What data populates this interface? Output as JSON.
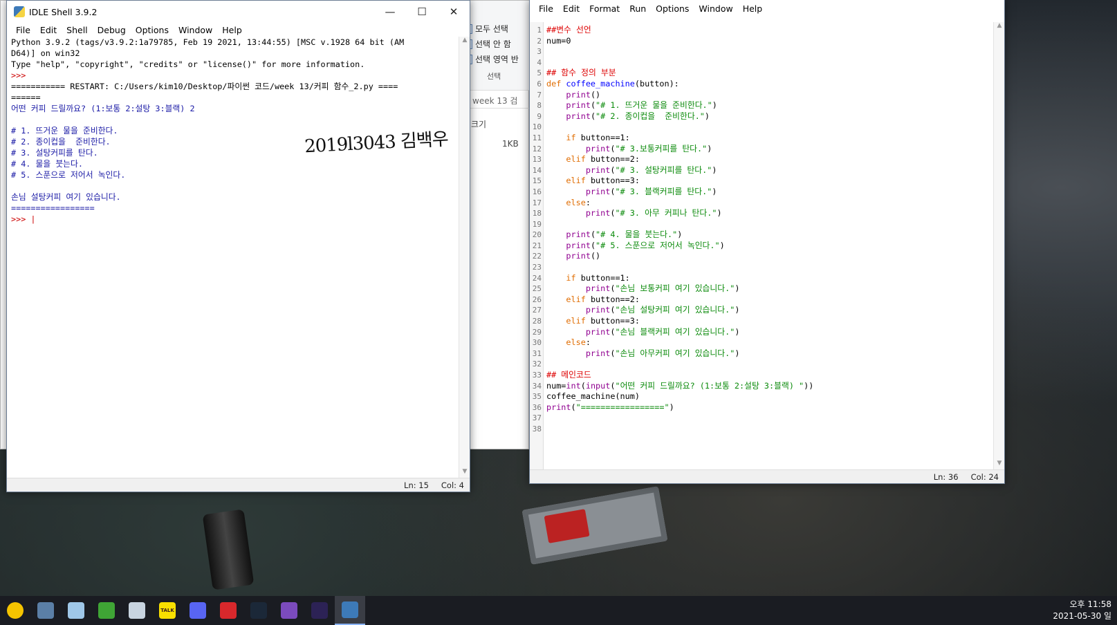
{
  "explorer": {
    "items": [
      "모두 선택",
      "선택 안 함",
      "선택 영역 반"
    ],
    "group_label": "선택",
    "search_text": "week 13 검",
    "col_size": "크기",
    "size_value": "1KB"
  },
  "shell": {
    "title": "IDLE Shell 3.9.2",
    "menu": [
      "File",
      "Edit",
      "Shell",
      "Debug",
      "Options",
      "Window",
      "Help"
    ],
    "lines": [
      {
        "t": "Python 3.9.2 (tags/v3.9.2:1a79785, Feb 19 2021, 13:44:55) [MSC v.1928 64 bit (AM",
        "c": "black"
      },
      {
        "t": "D64)] on win32",
        "c": "black"
      },
      {
        "t": "Type \"help\", \"copyright\", \"credits\" or \"license()\" for more information.",
        "c": "black"
      },
      {
        "t": ">>> ",
        "c": "red"
      },
      {
        "t": "=========== RESTART: C:/Users/kim10/Desktop/파이썬 코드/week 13/커피 함수_2.py ====",
        "c": "black"
      },
      {
        "t": "======",
        "c": "black"
      },
      {
        "t": "어떤 커피 드릴까요? (1:보통 2:설탕 3:블랙) 2",
        "c": "blue"
      },
      {
        "t": "",
        "c": "black"
      },
      {
        "t": "# 1. 뜨거운 물을 준비한다.",
        "c": "blue"
      },
      {
        "t": "# 2. 종이컵을  준비한다.",
        "c": "blue"
      },
      {
        "t": "# 3. 설탕커피를 탄다.",
        "c": "blue"
      },
      {
        "t": "# 4. 물을 붓는다.",
        "c": "blue"
      },
      {
        "t": "# 5. 스푼으로 저어서 녹인다.",
        "c": "blue"
      },
      {
        "t": "",
        "c": "black"
      },
      {
        "t": "손님 설탕커피 여기 있습니다.",
        "c": "blue"
      },
      {
        "t": "=================",
        "c": "blue"
      },
      {
        "t": ">>> |",
        "c": "red"
      }
    ],
    "signature": "2019l3043 김백우",
    "status_ln": "Ln: 15",
    "status_col": "Col: 4"
  },
  "editor": {
    "menu": [
      "File",
      "Edit",
      "Format",
      "Run",
      "Options",
      "Window",
      "Help"
    ],
    "line_numbers": [
      "1",
      "2",
      "3",
      "4",
      "5",
      "6",
      "7",
      "8",
      "9",
      "10",
      "11",
      "12",
      "13",
      "14",
      "15",
      "16",
      "17",
      "18",
      "19",
      "20",
      "21",
      "22",
      "23",
      "24",
      "25",
      "26",
      "27",
      "28",
      "29",
      "30",
      "31",
      "32",
      "33",
      "34",
      "35",
      "36",
      "37",
      "38"
    ],
    "code": [
      [
        [
          "cm",
          "##변수 선언"
        ]
      ],
      [
        [
          "",
          "num=0"
        ]
      ],
      [
        [
          "",
          ""
        ]
      ],
      [
        [
          "",
          ""
        ]
      ],
      [
        [
          "cm",
          "## 함수 정의 부분"
        ]
      ],
      [
        [
          "kw",
          "def "
        ],
        [
          "df",
          "coffee_machine"
        ],
        [
          "",
          "(button):"
        ]
      ],
      [
        [
          "",
          "    "
        ],
        [
          "bi",
          "print"
        ],
        [
          "",
          "()"
        ]
      ],
      [
        [
          "",
          "    "
        ],
        [
          "bi",
          "print"
        ],
        [
          "",
          "("
        ],
        [
          "str",
          "\"# 1. 뜨거운 물을 준비한다.\""
        ],
        [
          "",
          ")"
        ]
      ],
      [
        [
          "",
          "    "
        ],
        [
          "bi",
          "print"
        ],
        [
          "",
          "("
        ],
        [
          "str",
          "\"# 2. 종이컵을  준비한다.\""
        ],
        [
          "",
          ")"
        ]
      ],
      [
        [
          "",
          ""
        ]
      ],
      [
        [
          "",
          "    "
        ],
        [
          "kw",
          "if"
        ],
        [
          "",
          " button==1:"
        ]
      ],
      [
        [
          "",
          "        "
        ],
        [
          "bi",
          "print"
        ],
        [
          "",
          "("
        ],
        [
          "str",
          "\"# 3.보통커피를 탄다.\""
        ],
        [
          "",
          ")"
        ]
      ],
      [
        [
          "",
          "    "
        ],
        [
          "kw",
          "elif"
        ],
        [
          "",
          " button==2:"
        ]
      ],
      [
        [
          "",
          "        "
        ],
        [
          "bi",
          "print"
        ],
        [
          "",
          "("
        ],
        [
          "str",
          "\"# 3. 설탕커피를 탄다.\""
        ],
        [
          "",
          ")"
        ]
      ],
      [
        [
          "",
          "    "
        ],
        [
          "kw",
          "elif"
        ],
        [
          "",
          " button==3:"
        ]
      ],
      [
        [
          "",
          "        "
        ],
        [
          "bi",
          "print"
        ],
        [
          "",
          "("
        ],
        [
          "str",
          "\"# 3. 블랙커피를 탄다.\""
        ],
        [
          "",
          ")"
        ]
      ],
      [
        [
          "",
          "    "
        ],
        [
          "kw",
          "else"
        ],
        [
          "",
          ":"
        ]
      ],
      [
        [
          "",
          "        "
        ],
        [
          "bi",
          "print"
        ],
        [
          "",
          "("
        ],
        [
          "str",
          "\"# 3. 아무 커피나 탄다.\""
        ],
        [
          "",
          ")"
        ]
      ],
      [
        [
          "",
          ""
        ]
      ],
      [
        [
          "",
          "    "
        ],
        [
          "bi",
          "print"
        ],
        [
          "",
          "("
        ],
        [
          "str",
          "\"# 4. 물을 붓는다.\""
        ],
        [
          "",
          ")"
        ]
      ],
      [
        [
          "",
          "    "
        ],
        [
          "bi",
          "print"
        ],
        [
          "",
          "("
        ],
        [
          "str",
          "\"# 5. 스푼으로 저어서 녹인다.\""
        ],
        [
          "",
          ")"
        ]
      ],
      [
        [
          "",
          "    "
        ],
        [
          "bi",
          "print"
        ],
        [
          "",
          "()"
        ]
      ],
      [
        [
          "",
          ""
        ]
      ],
      [
        [
          "",
          "    "
        ],
        [
          "kw",
          "if"
        ],
        [
          "",
          " button==1:"
        ]
      ],
      [
        [
          "",
          "        "
        ],
        [
          "bi",
          "print"
        ],
        [
          "",
          "("
        ],
        [
          "str",
          "\"손님 보통커피 여기 있습니다.\""
        ],
        [
          "",
          ")"
        ]
      ],
      [
        [
          "",
          "    "
        ],
        [
          "kw",
          "elif"
        ],
        [
          "",
          " button==2:"
        ]
      ],
      [
        [
          "",
          "        "
        ],
        [
          "bi",
          "print"
        ],
        [
          "",
          "("
        ],
        [
          "str",
          "\"손님 설탕커피 여기 있습니다.\""
        ],
        [
          "",
          ")"
        ]
      ],
      [
        [
          "",
          "    "
        ],
        [
          "kw",
          "elif"
        ],
        [
          "",
          " button==3:"
        ]
      ],
      [
        [
          "",
          "        "
        ],
        [
          "bi",
          "print"
        ],
        [
          "",
          "("
        ],
        [
          "str",
          "\"손님 블랙커피 여기 있습니다.\""
        ],
        [
          "",
          ")"
        ]
      ],
      [
        [
          "",
          "    "
        ],
        [
          "kw",
          "else"
        ],
        [
          "",
          ":"
        ]
      ],
      [
        [
          "",
          "        "
        ],
        [
          "bi",
          "print"
        ],
        [
          "",
          "("
        ],
        [
          "str",
          "\"손님 아무커피 여기 있습니다.\""
        ],
        [
          "",
          ")"
        ]
      ],
      [
        [
          "",
          ""
        ]
      ],
      [
        [
          "cm",
          "## 메인코드"
        ]
      ],
      [
        [
          "",
          "num="
        ],
        [
          "bi",
          "int"
        ],
        [
          "",
          "("
        ],
        [
          "bi",
          "input"
        ],
        [
          "",
          "("
        ],
        [
          "str",
          "\"어떤 커피 드릴까요? (1:보통 2:설탕 3:블랙) \""
        ],
        [
          "",
          "))"
        ]
      ],
      [
        [
          "",
          "coffee_machine(num)"
        ]
      ],
      [
        [
          "bi",
          "print"
        ],
        [
          "",
          "("
        ],
        [
          "str",
          "\"=================\""
        ],
        [
          "",
          ")"
        ]
      ],
      [
        [
          "",
          ""
        ]
      ],
      [
        [
          "",
          ""
        ]
      ]
    ],
    "status_ln": "Ln: 36",
    "status_col": "Col: 24"
  },
  "taskbar": {
    "icons": [
      "play-icon",
      "calculator-icon",
      "notes-icon",
      "torrent-icon",
      "cloud-icon",
      "kakaotalk-icon",
      "discord-icon",
      "flash-icon",
      "steam-icon",
      "visual-studio-icon",
      "eclipse-icon",
      "python-idle-icon"
    ],
    "colors": [
      "#f5c400",
      "#5b7fa6",
      "#9fc7e8",
      "#3fa535",
      "#c8d4e0",
      "#f9e000",
      "#5865f2",
      "#d8282c",
      "#1b2838",
      "#7b4bbd",
      "#2c2255",
      "#3d7ab8"
    ],
    "kakao_label": "TALK",
    "time": "오후 11:58",
    "date": "2021-05-30 일"
  }
}
